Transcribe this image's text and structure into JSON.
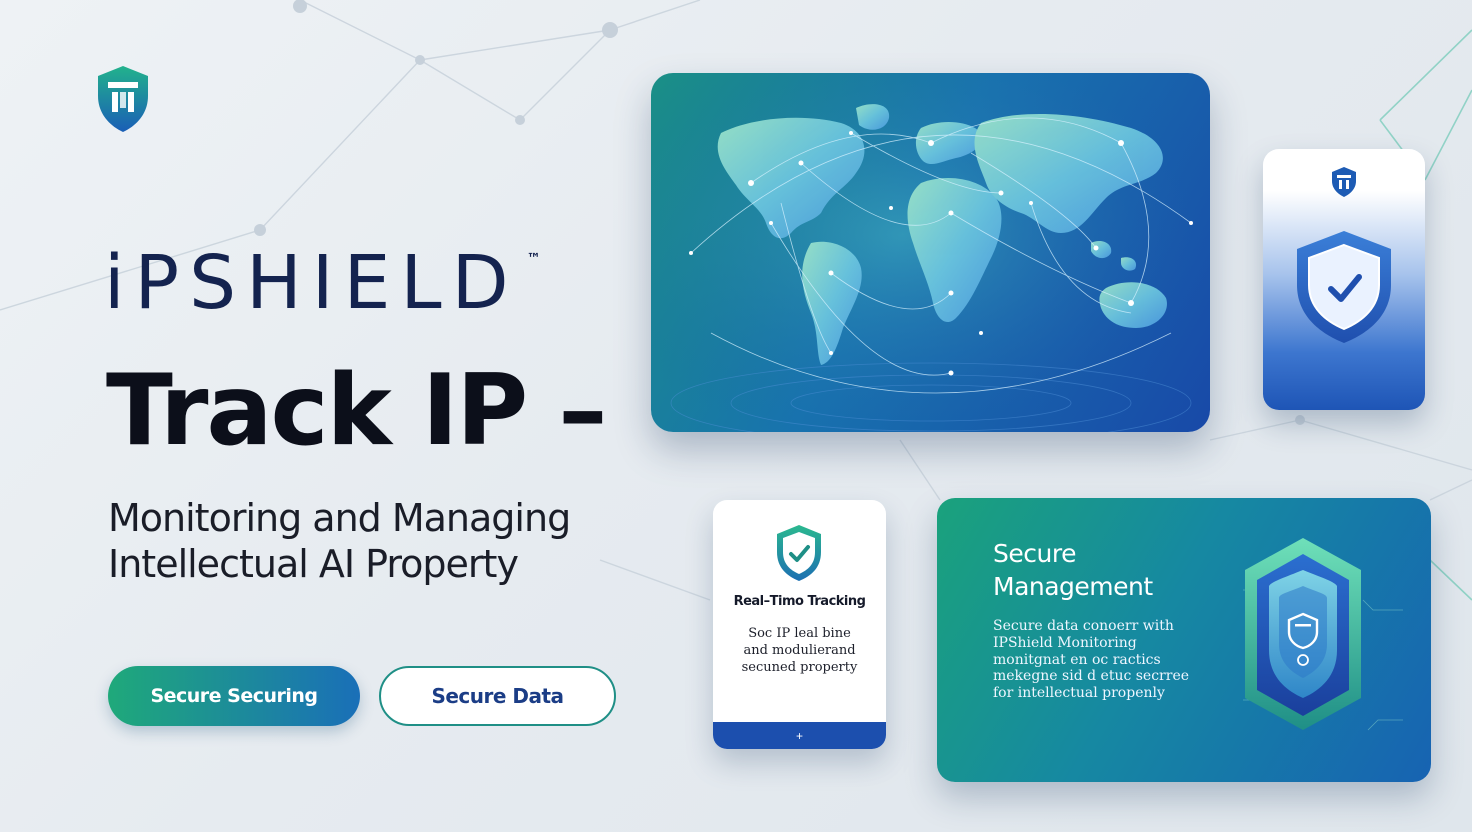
{
  "brand": {
    "name": "iPSHIELD",
    "trademark": "™"
  },
  "hero": {
    "headline": "Track IP –",
    "subline_1": "Monitoring and Managing",
    "subline_2": "Intellectual AI Property"
  },
  "buttons": {
    "primary_label": "Secure Securing",
    "secondary_label": "Secure Data"
  },
  "tracking_card": {
    "title": "Real–Timo Tracking",
    "body": "Soc IP leal bine\nand modulierand\nsecuned property",
    "footer_symbol": "+"
  },
  "secure_card": {
    "title_1": "Secure",
    "title_2": "Management",
    "body": "Secure data conoerr with\nIPShield Monitoring\nmonitgnat en oc ractics\nmekegne sid d etuc secrree\nfor intellectual propenly"
  },
  "colors": {
    "brand_navy": "#14234f",
    "accent_green": "#1fa97a",
    "accent_blue": "#1a6fb8",
    "card_blue": "#1849a8"
  },
  "icons": {
    "logo": "shield-icon",
    "map": "world-map-icon",
    "shield_check": "shield-check-icon",
    "shield_emblem": "shield-emblem-icon"
  }
}
